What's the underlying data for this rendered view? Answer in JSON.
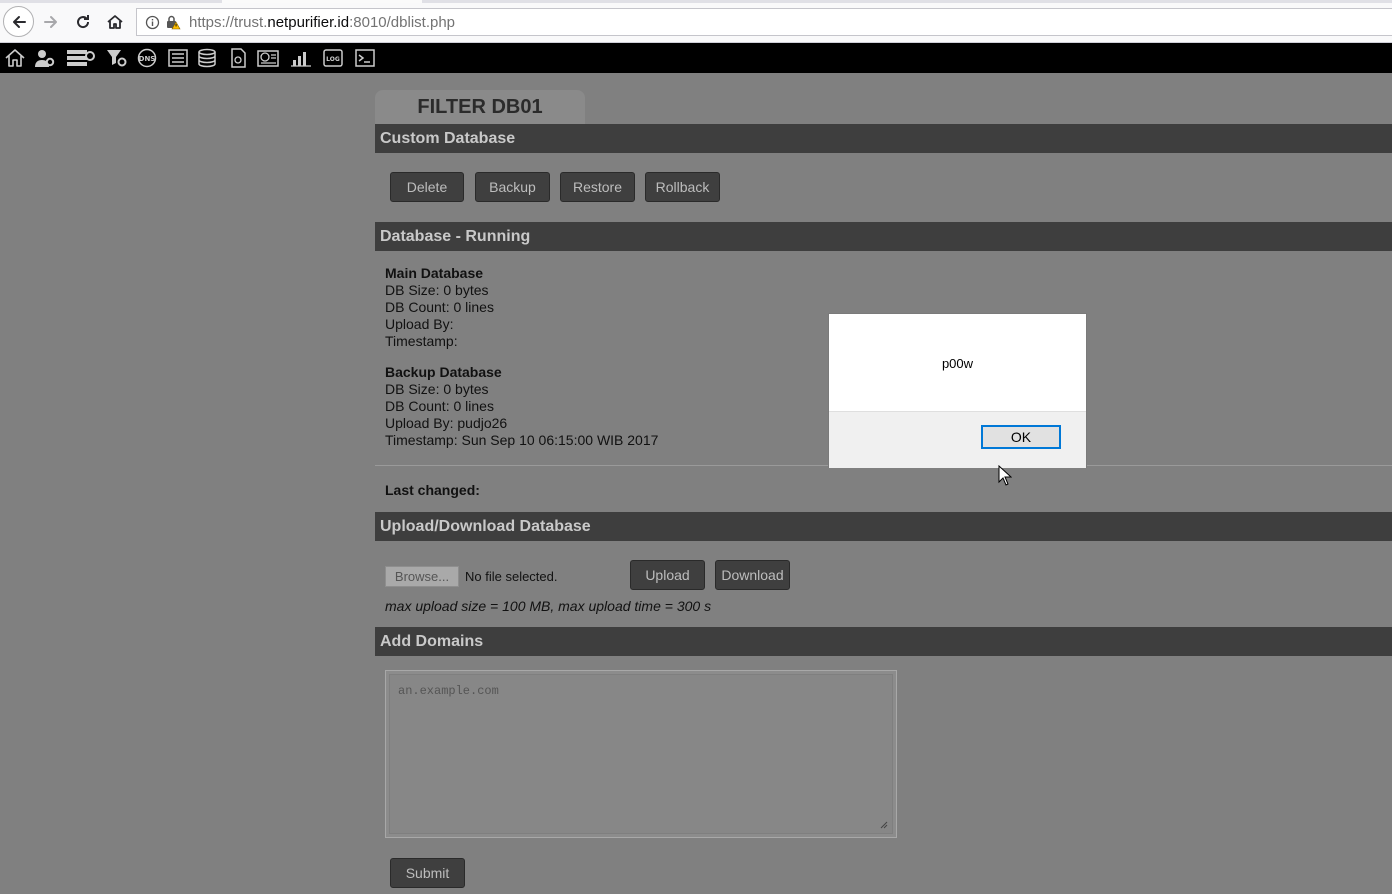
{
  "browser": {
    "url_prefix": "https://trust.",
    "url_domain": "netpurifier.id",
    "url_suffix": ":8010/dblist.php"
  },
  "toolbar": {
    "icons": [
      "home-icon",
      "user-settings-icon",
      "server-settings-icon",
      "filter-settings-icon",
      "dns-icon",
      "list-icon",
      "database-icon",
      "document-icon",
      "dashboard-icon",
      "chart-icon",
      "log-icon",
      "terminal-icon"
    ],
    "dns_label": "DNS",
    "log_label": "LOG"
  },
  "page": {
    "tab_title": "FILTER DB01",
    "custom_db": {
      "header": "Custom Database",
      "buttons": [
        "Delete",
        "Backup",
        "Restore",
        "Rollback"
      ]
    },
    "running": {
      "header": "Database - Running",
      "main": {
        "title": "Main Database",
        "size": "DB Size: 0 bytes",
        "count": "DB Count: 0 lines",
        "upload_by": "Upload By:",
        "timestamp": "Timestamp:"
      },
      "backup": {
        "title": "Backup Database",
        "size": "DB Size: 0 bytes",
        "count": "DB Count: 0 lines",
        "upload_by": "Upload By: pudjo26",
        "timestamp": "Timestamp: Sun Sep 10 06:15:00 WIB 2017"
      },
      "last_changed": "Last changed:"
    },
    "upload": {
      "header": "Upload/Download Database",
      "browse_label": "Browse...",
      "file_status": "No file selected.",
      "upload_label": "Upload",
      "download_label": "Download",
      "note": "max upload size = 100 MB, max upload time = 300 s"
    },
    "add_domains": {
      "header": "Add Domains",
      "placeholder": "an.example.com",
      "submit_label": "Submit"
    }
  },
  "dialog": {
    "message": "p00w",
    "ok_label": "OK"
  }
}
